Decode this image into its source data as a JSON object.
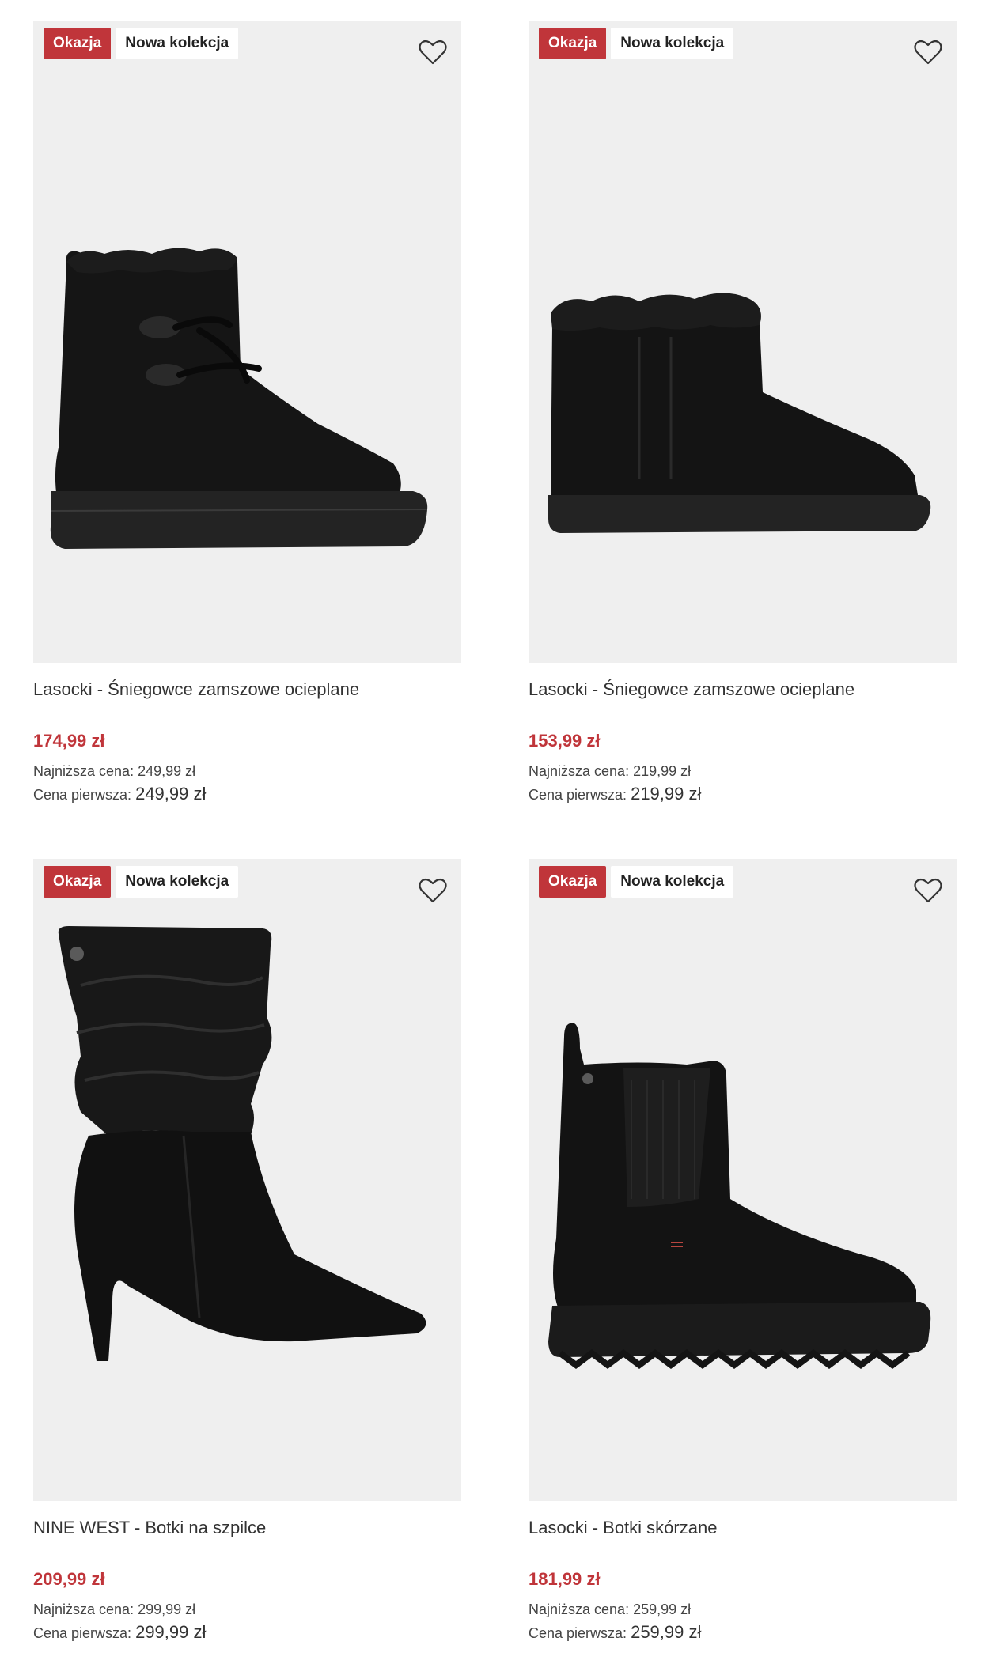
{
  "products": [
    {
      "badge_sale": "Okazja",
      "badge_new": "Nowa kolekcja",
      "title": "Lasocki - Śniegowce zamszowe ocieplane",
      "price": "174,99 zł",
      "lowest_label": "Najniższa cena:",
      "lowest_value": "249,99 zł",
      "first_label": "Cena pierwsza:",
      "first_value": "249,99 zł",
      "image": "black-suede-snow-boot-with-laces"
    },
    {
      "badge_sale": "Okazja",
      "badge_new": "Nowa kolekcja",
      "title": "Lasocki - Śniegowce zamszowe ocieplane",
      "price": "153,99 zł",
      "lowest_label": "Najniższa cena:",
      "lowest_value": "219,99 zł",
      "first_label": "Cena pierwsza:",
      "first_value": "219,99 zł",
      "image": "black-suede-low-snow-boot"
    },
    {
      "badge_sale": "Okazja",
      "badge_new": "Nowa kolekcja",
      "title": "NINE WEST - Botki na szpilce",
      "price": "209,99 zł",
      "lowest_label": "Najniższa cena:",
      "lowest_value": "299,99 zł",
      "first_label": "Cena pierwsza:",
      "first_value": "299,99 zł",
      "image": "black-leather-slouch-heel-boot"
    },
    {
      "badge_sale": "Okazja",
      "badge_new": "Nowa kolekcja",
      "title": "Lasocki - Botki skórzane",
      "price": "181,99 zł",
      "lowest_label": "Najniższa cena:",
      "lowest_value": "259,99 zł",
      "first_label": "Cena pierwsza:",
      "first_value": "259,99 zł",
      "image": "black-leather-chelsea-boot"
    }
  ],
  "colors": {
    "sale_red": "#c0353a",
    "image_bg": "#efefef",
    "text": "#333333"
  },
  "icons": {
    "favorite": "heart-outline-icon"
  }
}
